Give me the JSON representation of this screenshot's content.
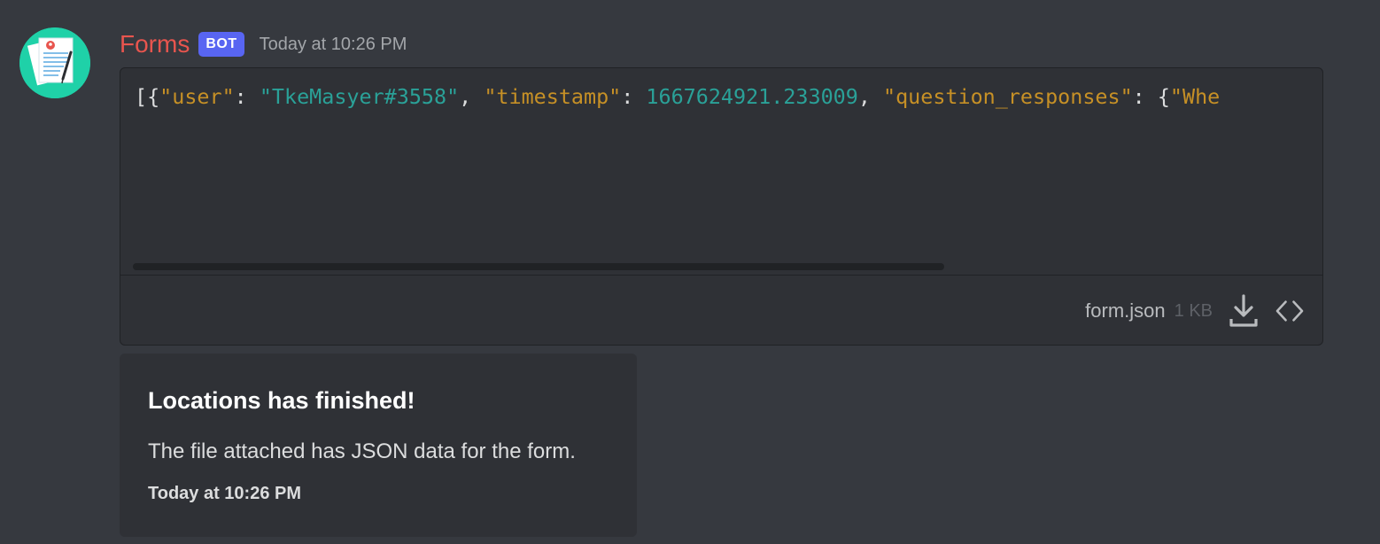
{
  "message": {
    "author": "Forms",
    "tag": "BOT",
    "timestamp": "Today at 10:26 PM"
  },
  "attachment": {
    "preview_tokens": [
      {
        "text": "[{",
        "kind": "punct"
      },
      {
        "text": "\"user\"",
        "kind": "key"
      },
      {
        "text": ": ",
        "kind": "punct"
      },
      {
        "text": "\"TkeMasyer#3558\"",
        "kind": "str"
      },
      {
        "text": ", ",
        "kind": "punct"
      },
      {
        "text": "\"timestamp\"",
        "kind": "key"
      },
      {
        "text": ": ",
        "kind": "punct"
      },
      {
        "text": "1667624921.233009",
        "kind": "num"
      },
      {
        "text": ", ",
        "kind": "punct"
      },
      {
        "text": "\"question_responses\"",
        "kind": "key"
      },
      {
        "text": ": {",
        "kind": "punct"
      },
      {
        "text": "\"Whe",
        "kind": "key"
      }
    ],
    "file_name": "form.json",
    "file_size": "1 KB",
    "icons": [
      "download-icon",
      "expand-code-icon"
    ]
  },
  "embed": {
    "title": "Locations has finished!",
    "description": "The file attached has JSON data for the form.",
    "footer": "Today at 10:26 PM"
  },
  "colors": {
    "username": "#e8554e",
    "bot_tag": "#5865f2",
    "avatar_bg": "#1fd1a8",
    "json_key": "#c69026",
    "json_value": "#2aa198"
  }
}
